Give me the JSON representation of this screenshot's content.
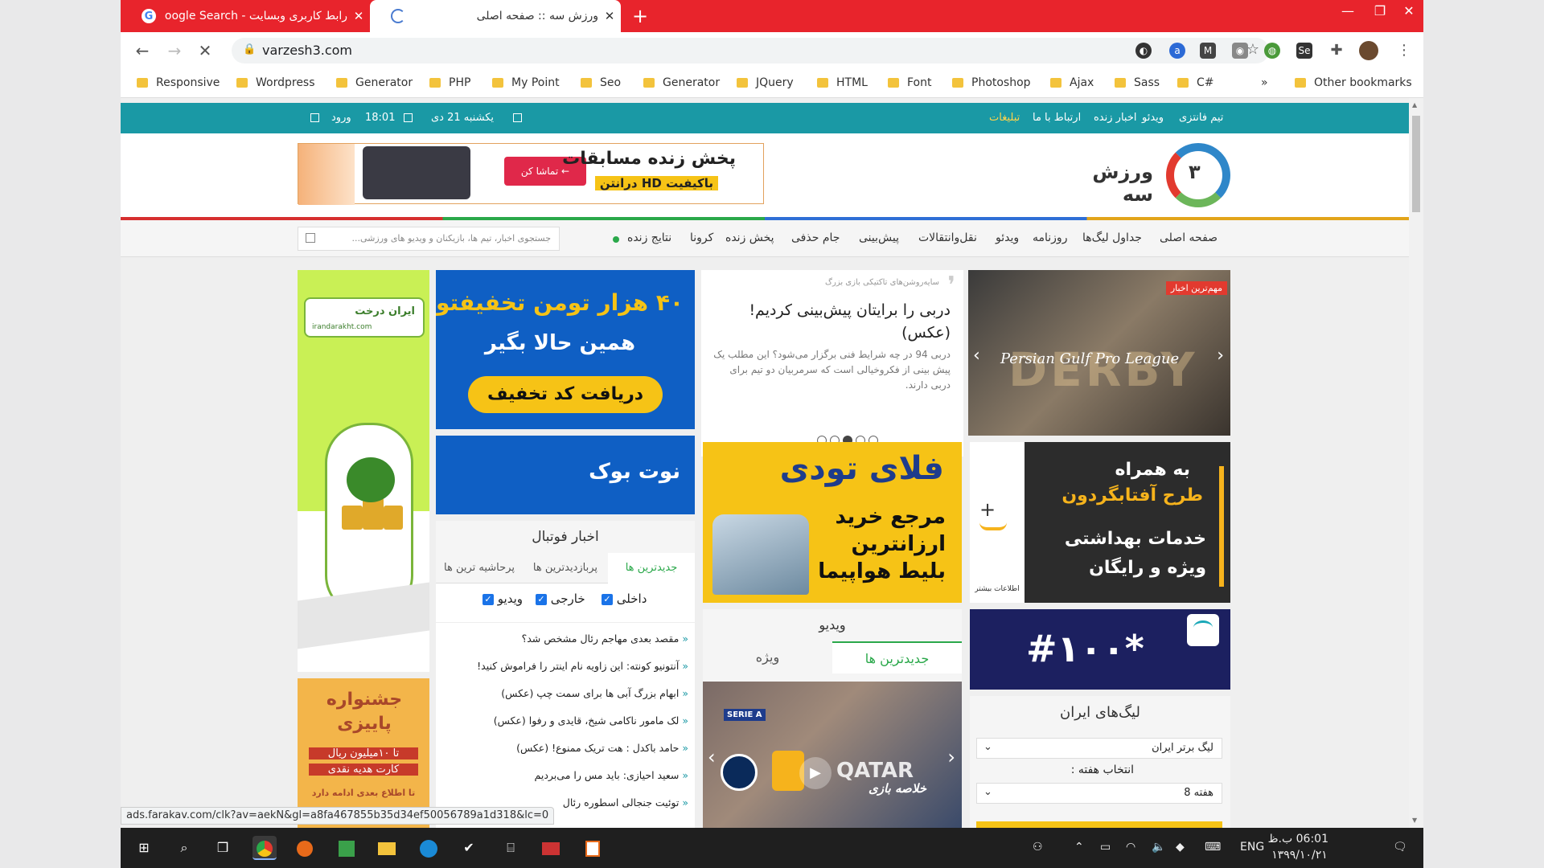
{
  "browser": {
    "tabs": [
      {
        "title": "رابط کاربری وبسایت - Google Search",
        "favicon": "G"
      },
      {
        "title": "ورزش سه :: صفحه اصلی"
      }
    ],
    "url": "varzesh3.com",
    "bookmarks": [
      "Responsive",
      "Wordpress",
      "Generator",
      "PHP",
      "My Point",
      "Seo",
      "Generator",
      "JQuery",
      "HTML",
      "Font",
      "Photoshop",
      "Ajax",
      "Sass",
      "C#"
    ],
    "more_bookmarks": "»",
    "other_bookmarks": "Other bookmarks",
    "status_url": "ads.farakav.com/clk?av=aekN&gl=a8fa467855b35d34ef50056789a1d318&lc=0"
  },
  "site": {
    "topbar_links": [
      "تیم فانتزی",
      "ویدئو",
      "اخبار زنده",
      "ارتباط با ما",
      "تبلیغات"
    ],
    "date": "یکشنبه 21 دی",
    "time": "18:01",
    "login": "ورود",
    "banner_btn": "تماشا کن ←",
    "banner_title": "پخش زنده مسابقات",
    "banner_sub": "باکیفیت HD درانتن",
    "logo_text": "ورزش سه",
    "logo_mark": "٣",
    "nav": [
      "صفحه اصلی",
      "جداول لیگ‌ها",
      "روزنامه",
      "ویدئو",
      "نقل‌وانتقالات",
      "پیش‌بینی",
      "جام حذفی",
      "پخش زنده",
      "کرونا",
      "نتایج زنده"
    ],
    "search_placeholder": "جستجوی اخبار، تیم ها، بازیکنان و ویدیو های ورزشی...",
    "featured": {
      "badge": "مهم‌ترین اخبار",
      "kicker": "سایه‌روشن‌های تاکتیکی بازی بزرگ",
      "title": "دربی را برایتان پیش‌بینی کردیم! (عکس)",
      "lead": "دربی 94 در چه شرایط فنی برگزار می‌شود؟ این مطلب یک پیش بینی از فکروخیالی است که سرمربیان دو تیم برای دربی دارند.",
      "image_caption": "Persian Gulf Pro League",
      "image_bg": "DERBY"
    },
    "ads": {
      "discount_line1": "۴۰ هزار تومن تخفیفتو",
      "discount_line2": "همین حالا بگیر",
      "discount_btn": "دریافت کد تخفیف",
      "notebook": "نوت بوک",
      "flytoday_logo": "فلای تودی",
      "flytoday_line1": "مرجع خرید",
      "flytoday_line2": "ارزانترین",
      "flytoday_line3": "بلیط هواپیما",
      "aftab_line1": "به همراه",
      "aftab_line2": "طرح آفتابگردون",
      "aftab_line3": "خدمات بهداشتی",
      "aftab_line4": "ویژه و رایگان",
      "aftab_more": "اطلاعات بیشتر",
      "aftab_plus": "+",
      "hashtag": "#۱۰۰*",
      "iran_derakht_brand": "ایران درخت",
      "iran_derakht_sub": "irandarakht.com",
      "festival_line1": "جشنواره",
      "festival_line2": "پاییزی",
      "festival_line3": "تا ۱۰میلیون ریال",
      "festival_line4": "کارت هدیه نقدی",
      "festival_line5": "تا اطلاع بعدی ادامه دارد"
    },
    "football_news": {
      "title": "اخبار فوتبال",
      "tabs": [
        "جدیدترین ها",
        "پربازدیدترین ها",
        "پرحاشیه ترین ها"
      ],
      "filters": [
        "داخلی",
        "خارجی",
        "ویدیو"
      ],
      "items": [
        "مقصد بعدی مهاجم رئال مشخص شد؟",
        "آنتونیو کونته: این زاویه نام اینتر را فراموش کنید!",
        "ابهام بزرگ آبی ها برای سمت چپ (عکس)",
        "لک مامور ناکامی شیخ، قایدی و رفوا (عکس)",
        "حامد باکدل : هت تریک ممنوع! (عکس)",
        "سعید احیازی: باید مس را می‌بردیم",
        "توئیت جنجالی اسطوره رئال"
      ]
    },
    "video": {
      "title": "ویدیو",
      "tabs": [
        "ویژه",
        "جدیدترین ها"
      ],
      "caption": "خلاصه بازی",
      "league_badge": "SERIE A",
      "sponsor": "QATAR"
    },
    "leagues": {
      "title": "لیگ‌های ایران",
      "league_select": "لیگ برتر ایران",
      "week_label": "انتخاب هفته :",
      "week_select": "هفته 8"
    }
  },
  "taskbar": {
    "lang": "ENG",
    "time": "06:01 ب.ظ",
    "date": "۱۳۹۹/۱۰/۲۱"
  },
  "colors": {
    "tabbar": "#e8242c",
    "site_teal": "#1a99a5",
    "ad_blue": "#0f5fc4",
    "ad_yellow": "#f6c316"
  }
}
